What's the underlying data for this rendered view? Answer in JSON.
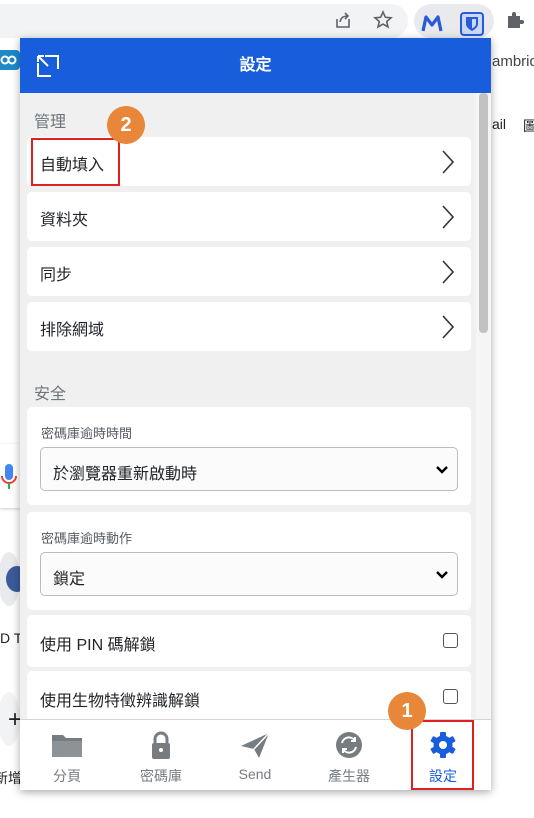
{
  "browser": {
    "ext_badge_text": "M",
    "bg_texts": {
      "top_right": "ambrid",
      "mail": "ail",
      "tile_a": "D T",
      "tile_b": "新增"
    }
  },
  "header": {
    "title": "設定",
    "popout_icon": "popout-icon"
  },
  "sections": {
    "manage_label": "管理",
    "security_label": "安全"
  },
  "manage_items": [
    {
      "label": "自動填入"
    },
    {
      "label": "資料夾"
    },
    {
      "label": "同步"
    },
    {
      "label": "排除網域"
    }
  ],
  "security": {
    "timeout": {
      "label": "密碼庫逾時時間",
      "value": "於瀏覽器重新啟動時"
    },
    "timeout_action": {
      "label": "密碼庫逾時動作",
      "value": "鎖定"
    },
    "pin_unlock": {
      "label": "使用 PIN 碼解鎖",
      "checked": false
    },
    "bio_unlock": {
      "label": "使用生物特徵辨識解鎖",
      "checked": false
    }
  },
  "tabs": [
    {
      "label": "分頁",
      "icon": "folder-icon"
    },
    {
      "label": "密碼庫",
      "icon": "lock-icon"
    },
    {
      "label": "Send",
      "icon": "send-icon"
    },
    {
      "label": "產生器",
      "icon": "generator-icon"
    },
    {
      "label": "設定",
      "icon": "gear-icon",
      "active": true
    }
  ],
  "annotations": {
    "badge_1": "1",
    "badge_2": "2"
  },
  "colors": {
    "brand": "#175ddc",
    "annotation_red": "#e02020",
    "badge_orange": "#e8863a"
  }
}
